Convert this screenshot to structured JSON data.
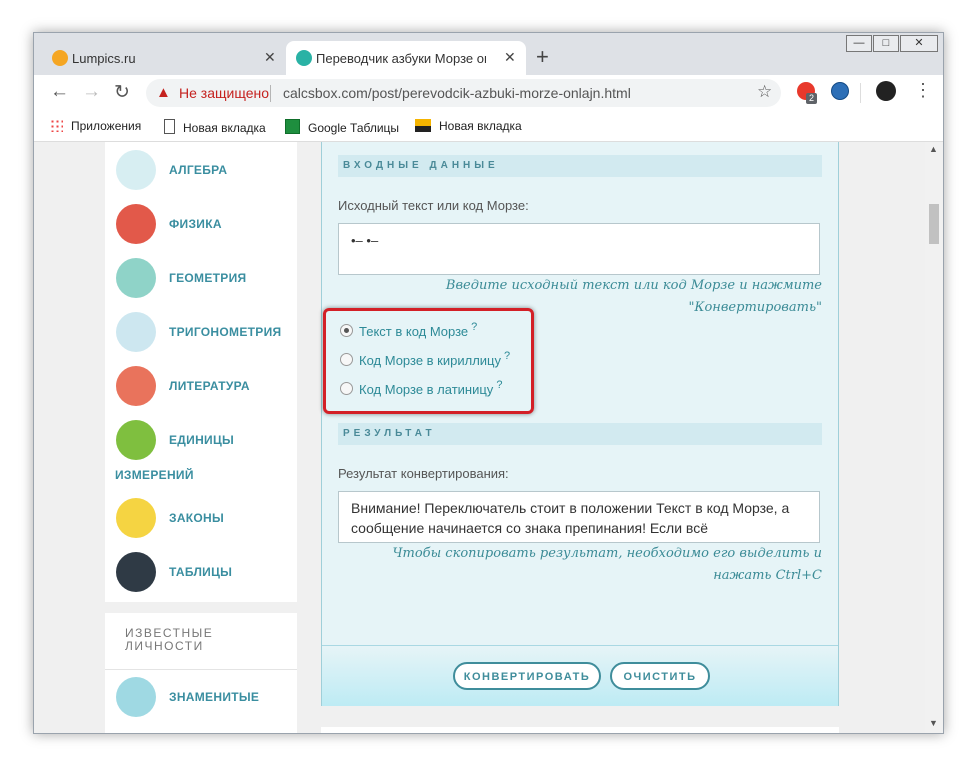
{
  "tabs": [
    {
      "title": "Lumpics.ru",
      "favicon_color": "#f5a623"
    },
    {
      "title": "Переводчик азбуки Морзе онлайн",
      "favicon_color": "#2ab2a5",
      "active": true
    }
  ],
  "window_controls": [
    "—",
    "□",
    "✕"
  ],
  "omnibox": {
    "security": "Не защищено",
    "url": "calcsbox.com/post/perevodcik-azbuki-morze-onlajn.html"
  },
  "extensions": {
    "badge": "2"
  },
  "bookmarks": [
    {
      "label": "Приложения",
      "icon": "apps-grid-icon"
    },
    {
      "label": "Новая вкладка",
      "icon": "page-icon"
    },
    {
      "label": "Google Таблицы",
      "icon": "sheets-icon"
    },
    {
      "label": "Новая вкладка",
      "icon": "image-icon"
    }
  ],
  "sidebar": {
    "categories": [
      {
        "label": "АЛГЕБРА",
        "color": "#d7eef2"
      },
      {
        "label": "ФИЗИКА",
        "color": "#e2594a"
      },
      {
        "label": "ГЕОМЕТРИЯ",
        "color": "#8fd3c8"
      },
      {
        "label": "ТРИГОНОМЕТРИЯ",
        "color": "#cde7f0"
      },
      {
        "label": "ЛИТЕРАТУРА",
        "color": "#e9735c"
      },
      {
        "label": "ЕДИНИЦЫ",
        "label2": "ИЗМЕРЕНИЙ",
        "color": "#7fbf3f"
      },
      {
        "label": "ЗАКОНЫ",
        "color": "#f5d442"
      },
      {
        "label": "ТАБЛИЦЫ",
        "color": "#2f3a45"
      }
    ],
    "famous_title": "ИЗВЕСТНЫЕ ЛИЧНОСТИ",
    "famous_items": [
      {
        "label": "ЗНАМЕНИТЫЕ",
        "color": "#9fd9e3"
      }
    ]
  },
  "converter": {
    "input_section": "ВХОДНЫЕ ДАННЫЕ",
    "input_label": "Исходный текст или код Морзе:",
    "input_value": "•– •–",
    "input_hint_1": "Введите исходный текст или код Морзе и нажмите",
    "input_hint_2": "\"Конвертировать\"",
    "modes": [
      {
        "label": "Текст в код Морзе",
        "selected": true
      },
      {
        "label": "Код Морзе в кириллицу",
        "selected": false
      },
      {
        "label": "Код Морзе в латиницу",
        "selected": false
      }
    ],
    "help_mark": "?",
    "result_section": "РЕЗУЛЬТАТ",
    "result_label": "Результат конвертирования:",
    "result_value": "Внимание! Переключатель стоит в положении Текст в код Морзе, а сообщение начинается со знака препинания! Если всё",
    "result_hint_1": "Чтобы скопировать результат, необходимо его выделить и",
    "result_hint_2": "нажать Ctrl+C",
    "convert_button": "КОНВЕРТИРОВАТЬ",
    "clear_button": "ОЧИСТИТЬ"
  },
  "colors": {
    "accent": "#3f8d9b",
    "highlight": "#d32027",
    "warning": "#c5221f"
  }
}
